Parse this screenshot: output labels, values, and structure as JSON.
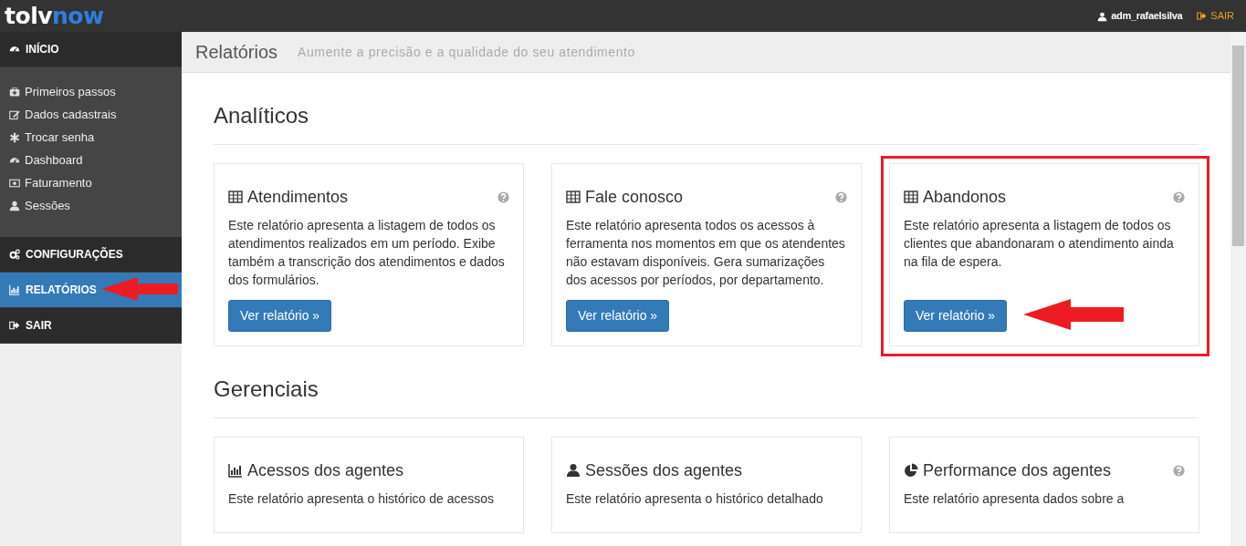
{
  "brand": {
    "part_1": "tolv",
    "part_2": "now"
  },
  "topbar": {
    "user": "adm_rafaelsilva",
    "logout": "SAIR"
  },
  "sidebar": [
    {
      "kind": "header",
      "label": "INÍCIO",
      "selected": false,
      "pointed": false
    },
    {
      "kind": "group",
      "children": [
        {
          "label": "Primeiros passos"
        },
        {
          "label": "Dados cadastrais"
        },
        {
          "label": "Trocar senha"
        },
        {
          "label": "Dashboard"
        },
        {
          "label": "Faturamento"
        },
        {
          "label": "Sessões"
        }
      ]
    },
    {
      "kind": "header",
      "label": "CONFIGURAÇÕES",
      "selected": false,
      "pointed": false
    },
    {
      "kind": "header",
      "label": "RELATÓRIOS",
      "selected": true,
      "pointed": true
    },
    {
      "kind": "header",
      "label": "SAIR",
      "selected": false,
      "pointed": false
    }
  ],
  "page_header": {
    "title": "Relatórios",
    "subtitle": "Aumente a precisão e a qualidade do seu atendimento"
  },
  "sections": [
    {
      "title": "Analíticos",
      "cards": [
        {
          "title": "Atendimentos",
          "help": true,
          "highlighted": false,
          "text": "Este relatório apresenta a listagem de todos os atendimentos realizados em um período. Exibe também a transcrição dos atendimentos e dados dos formulários.",
          "button": "Ver relatório »"
        },
        {
          "title": "Fale conosco",
          "help": true,
          "highlighted": false,
          "text": "Este relatório apresenta todos os acessos à ferramenta nos momentos em que os atendentes não estavam disponíveis. Gera sumarizações dos acessos por períodos, por departamento.",
          "button": "Ver relatório »"
        },
        {
          "title": "Abandonos",
          "help": true,
          "highlighted": true,
          "text": "Este relatório apresenta a listagem de todos os clientes que abandonaram o atendimento ainda na fila de espera.",
          "button": "Ver relatório »"
        }
      ]
    },
    {
      "title": "Gerenciais",
      "cards": [
        {
          "title": "Acessos dos agentes",
          "help": false,
          "highlighted": false,
          "text": "Este relatório apresenta o histórico de acessos"
        },
        {
          "title": "Sessões dos agentes",
          "help": false,
          "highlighted": false,
          "text": "Este relatório apresenta o histórico detalhado"
        },
        {
          "title": "Performance dos agentes",
          "help": true,
          "highlighted": false,
          "text": "Este relatório apresenta dados sobre a"
        }
      ]
    }
  ]
}
